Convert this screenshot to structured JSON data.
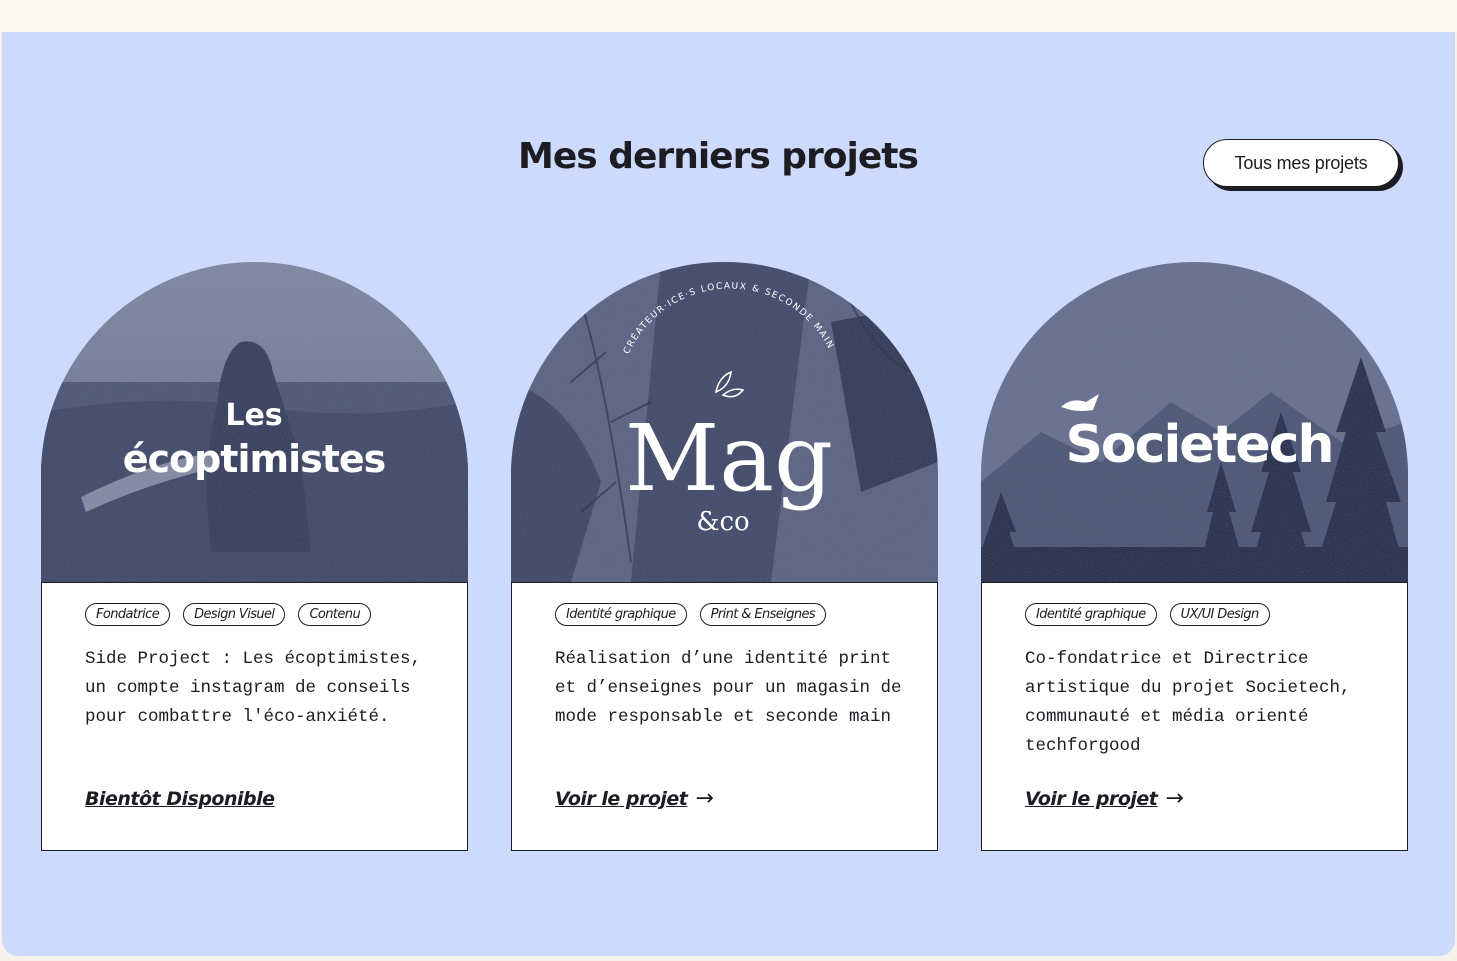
{
  "section": {
    "title": "Mes derniers projets",
    "all_projects_label": "Tous mes projets"
  },
  "colors": {
    "panel_bg": "#cedafc",
    "ink": "#1c1c22",
    "card_bg": "#ffffff",
    "photo_tint": "#4a5578"
  },
  "cards": [
    {
      "logo": "Les écoptimistes",
      "logo_line1": "Les",
      "logo_line2": "écoptimistes",
      "tags": [
        "Fondatrice",
        "Design Visuel",
        "Contenu"
      ],
      "description": "Side Project : Les écoptimistes, un compte instagram de conseils pour combattre l'éco-anxiété.",
      "link_label": "Bientôt Disponible",
      "link_icon": ""
    },
    {
      "logo": "Mag & co",
      "logo_main": "Mag",
      "logo_sub": "&co",
      "logo_arc": "CRÉATEUR·ICE·S LOCAUX & SECONDE MAIN",
      "tags": [
        "Identité graphique",
        "Print & Enseignes"
      ],
      "description": "Réalisation d’une identité print et d’enseignes pour un magasin de mode responsable et seconde main",
      "link_label": "Voir le projet",
      "link_icon": "→"
    },
    {
      "logo": "Societech",
      "tags": [
        "Identité graphique",
        "UX/UI Design"
      ],
      "description": "Co-fondatrice et Directrice artistique du projet Societech, communauté et média orienté techforgood",
      "link_label": "Voir le projet",
      "link_icon": "→"
    }
  ]
}
